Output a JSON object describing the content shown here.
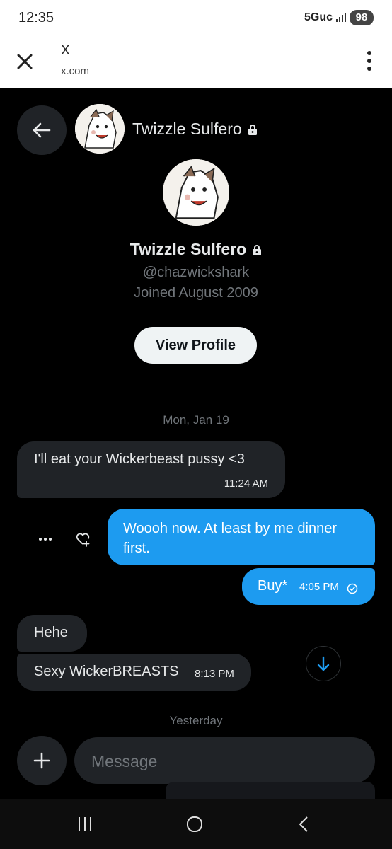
{
  "status_bar": {
    "time": "12:35",
    "network": "5Guc",
    "battery": "98"
  },
  "browser": {
    "title": "X",
    "url": "x.com"
  },
  "chat_header": {
    "name": "Twizzle Sulfero"
  },
  "profile": {
    "name": "Twizzle Sulfero",
    "handle": "@chazwickshark",
    "joined": "Joined August 2009",
    "view_profile_label": "View Profile"
  },
  "messages": [
    {
      "date_label": "Mon, Jan 19"
    },
    {
      "direction": "in",
      "text": "I'll eat your Wickerbeast pussy <3",
      "time": "11:24 AM"
    },
    {
      "direction": "out",
      "text": "Woooh now. At least by me dinner first."
    },
    {
      "direction": "out",
      "text": "Buy*",
      "time": "4:05 PM",
      "status": "read-check-icon"
    },
    {
      "direction": "in",
      "text": "Hehe"
    },
    {
      "direction": "in",
      "text": "Sexy WickerBREASTS",
      "time": "8:13 PM"
    },
    {
      "date_label": "Yesterday"
    }
  ],
  "composer": {
    "placeholder": "Message"
  },
  "colors": {
    "accent": "#1d9bf0",
    "incoming_bubble": "#202327",
    "background": "#000000",
    "muted_text": "#71767b"
  },
  "icons": [
    "close-icon",
    "kebab-menu-icon",
    "back-arrow-icon",
    "lock-icon",
    "more-dots-icon",
    "heart-add-icon",
    "read-check-icon",
    "arrow-down-icon",
    "plus-icon",
    "recents-icon",
    "home-icon",
    "android-back-icon"
  ]
}
